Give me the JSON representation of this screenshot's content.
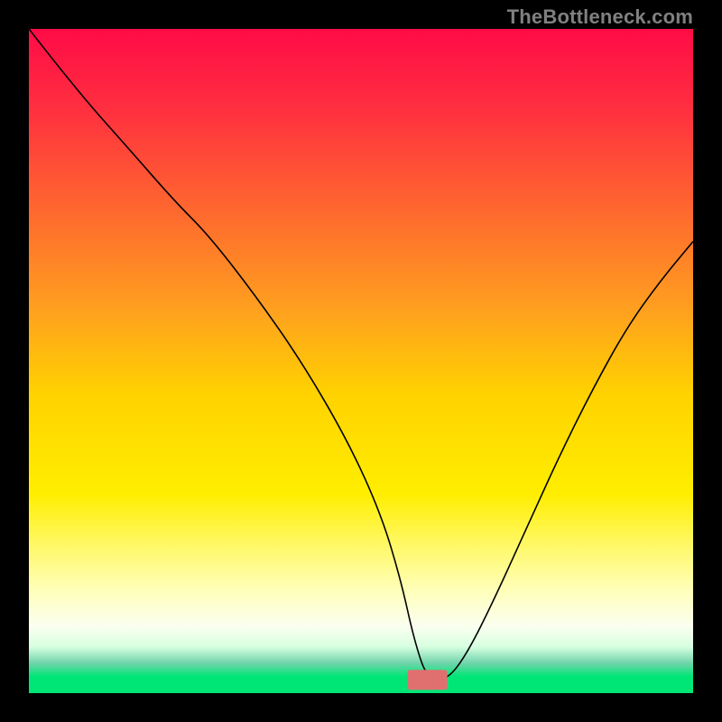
{
  "watermark": "TheBottleneck.com",
  "chart_data": {
    "type": "line",
    "title": "",
    "xlabel": "",
    "ylabel": "",
    "xlim": [
      0,
      100
    ],
    "ylim": [
      0,
      100
    ],
    "grid": false,
    "legend": false,
    "background_gradient": {
      "stops": [
        {
          "offset": 0.0,
          "color": "#ff0b47"
        },
        {
          "offset": 0.12,
          "color": "#ff2f3f"
        },
        {
          "offset": 0.28,
          "color": "#ff6a2e"
        },
        {
          "offset": 0.42,
          "color": "#ff9f1f"
        },
        {
          "offset": 0.55,
          "color": "#ffd200"
        },
        {
          "offset": 0.7,
          "color": "#ffee00"
        },
        {
          "offset": 0.78,
          "color": "#fff96a"
        },
        {
          "offset": 0.85,
          "color": "#ffffbf"
        },
        {
          "offset": 0.9,
          "color": "#fafff0"
        },
        {
          "offset": 0.93,
          "color": "#d7ffe0"
        },
        {
          "offset": 0.955,
          "color": "#6fd4ab"
        },
        {
          "offset": 0.975,
          "color": "#00e676"
        },
        {
          "offset": 1.0,
          "color": "#00e676"
        }
      ]
    },
    "marker": {
      "x": 60,
      "y": 2,
      "color": "#e07070",
      "rx": 3,
      "width": 6,
      "height": 3
    },
    "series": [
      {
        "name": "bottleneck-curve",
        "color": "#000000",
        "stroke_width": 1.6,
        "x": [
          0,
          7,
          15,
          22,
          27,
          34,
          41,
          48,
          53,
          56,
          58,
          60,
          63,
          66,
          70,
          75,
          80,
          85,
          90,
          95,
          100
        ],
        "y": [
          100,
          91,
          82,
          74,
          69,
          60,
          50,
          38,
          27,
          17,
          8,
          2,
          2,
          6,
          14,
          25,
          36,
          46,
          55,
          62,
          68
        ]
      }
    ]
  }
}
